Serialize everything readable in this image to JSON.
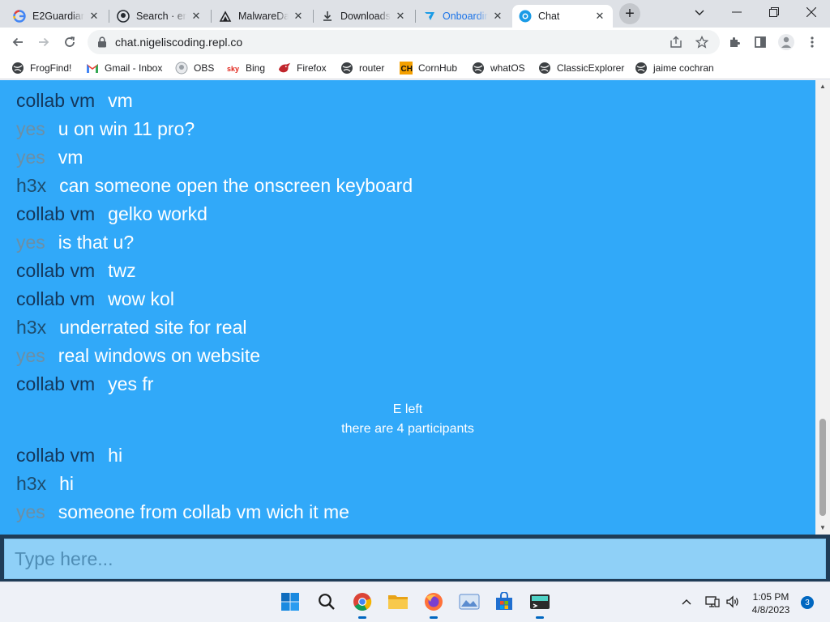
{
  "browser": {
    "tabs": [
      {
        "title": "E2Guardian",
        "icon": "google-icon"
      },
      {
        "title": "Search · en",
        "icon": "github-icon"
      },
      {
        "title": "MalwareDa",
        "icon": "malware-icon"
      },
      {
        "title": "Downloads",
        "icon": "download-icon"
      },
      {
        "title": "Onboardin",
        "icon": "onboarding-icon"
      },
      {
        "title": "Chat",
        "icon": "chat-icon",
        "active": true
      }
    ],
    "url": "chat.nigeliscoding.repl.co",
    "bookmarks": [
      {
        "label": "FrogFind!",
        "icon": "globe-icon"
      },
      {
        "label": "Gmail - Inbox",
        "icon": "gmail-icon"
      },
      {
        "label": "OBS",
        "icon": "github-icon"
      },
      {
        "label": "Bing",
        "icon": "sky-icon"
      },
      {
        "label": "Firefox",
        "icon": "firefox-icon"
      },
      {
        "label": "router",
        "icon": "globe-icon"
      },
      {
        "label": "CornHub",
        "icon": "ch-icon"
      },
      {
        "label": "whatOS",
        "icon": "globe-icon"
      },
      {
        "label": "ClassicExplorer",
        "icon": "globe-icon"
      },
      {
        "label": "jaime cochran",
        "icon": "globe-icon"
      }
    ]
  },
  "chat": {
    "messages": [
      {
        "user": "collab vm",
        "text": "vm",
        "kind": "collab"
      },
      {
        "user": "yes",
        "text": "u on win 11 pro?",
        "kind": "yes"
      },
      {
        "user": "yes",
        "text": "vm",
        "kind": "yes"
      },
      {
        "user": "h3x",
        "text": "can someone open the onscreen keyboard",
        "kind": "h3x"
      },
      {
        "user": "collab vm",
        "text": "gelko workd",
        "kind": "collab"
      },
      {
        "user": "yes",
        "text": "is that u?",
        "kind": "yes"
      },
      {
        "user": "collab vm",
        "text": "twz",
        "kind": "collab"
      },
      {
        "user": "collab vm",
        "text": "wow kol",
        "kind": "collab"
      },
      {
        "user": "h3x",
        "text": "underrated site for real",
        "kind": "h3x"
      },
      {
        "user": "yes",
        "text": "real windows on website",
        "kind": "yes"
      },
      {
        "user": "collab vm",
        "text": "yes fr",
        "kind": "collab"
      }
    ],
    "system": [
      "E left",
      "there are 4 participants"
    ],
    "messages_after": [
      {
        "user": "collab vm",
        "text": "hi",
        "kind": "collab"
      },
      {
        "user": "h3x",
        "text": "hi",
        "kind": "h3x"
      },
      {
        "user": "yes",
        "text": "someone from collab vm wich it me",
        "kind": "yes"
      }
    ],
    "input_placeholder": "Type here..."
  },
  "taskbar": {
    "time": "1:05 PM",
    "date": "4/8/2023",
    "notifications": "3"
  },
  "colors": {
    "chat_bg": "#31a9f9",
    "input_bar": "#1f3c57",
    "input_box": "#8fd0f7"
  }
}
